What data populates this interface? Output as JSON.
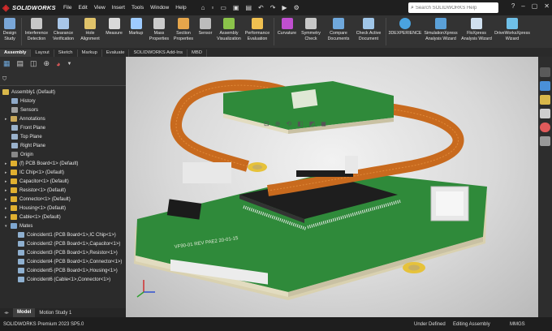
{
  "app": {
    "brand": "SOLIDWORKS"
  },
  "menu": [
    "File",
    "Edit",
    "View",
    "Insert",
    "Tools",
    "Window",
    "Help"
  ],
  "quick_access": [
    "home-icon",
    "new-icon",
    "open-icon",
    "save-icon",
    "print-icon",
    "undo-icon",
    "redo-icon",
    "rebuild-icon",
    "options-icon"
  ],
  "search": {
    "placeholder": "Search SOLIDWORKS Help"
  },
  "ribbon": [
    {
      "label": "Design\nStudy",
      "color": "#7aa7d8"
    },
    {
      "label": "Interference\nDetection",
      "color": "#c7c7c7"
    },
    {
      "label": "Clearance\nVerification",
      "color": "#a8c6e8"
    },
    {
      "label": "Hole\nAlignment",
      "color": "#e0c36a"
    },
    {
      "label": "Measure",
      "color": "#d9d9d9"
    },
    {
      "label": "Markup",
      "color": "#9ecbff"
    },
    {
      "label": "Mass\nProperties",
      "color": "#cccccc"
    },
    {
      "label": "Section\nProperties",
      "color": "#e6a64b"
    },
    {
      "label": "Sensor",
      "color": "#bcbcbc"
    },
    {
      "label": "Assembly\nVisualization",
      "color": "#8bc34a"
    },
    {
      "label": "Performance\nEvaluation",
      "color": "#f0c050"
    },
    {
      "label": "Curvature",
      "color": "#c04fd0"
    },
    {
      "label": "Symmetry\nCheck",
      "color": "#c8c8c8"
    },
    {
      "label": "Compare\nDocuments",
      "color": "#6fa8dc"
    },
    {
      "label": "Check Active\nDocument",
      "color": "#9fc5e8"
    },
    {
      "label": "3DEXPERIENCE",
      "color": "#4aa3df"
    },
    {
      "label": "SimulationXpress\nAnalysis Wizard",
      "color": "#5aa0d8"
    },
    {
      "label": "FloXpress\nAnalysis Wizard",
      "color": "#d0e0f0"
    },
    {
      "label": "DriveWorksXpress\nWizard",
      "color": "#6fc0e8"
    }
  ],
  "tabs": [
    "Assembly",
    "Layout",
    "Sketch",
    "Markup",
    "Evaluate",
    "SOLIDWORKS Add-Ins",
    "MBD"
  ],
  "active_tab": "Assembly",
  "tree": {
    "root": "Assembly1  (Default)",
    "items": [
      {
        "label": "History",
        "icon": "history-icon"
      },
      {
        "label": "Sensors",
        "icon": "sensors-icon"
      },
      {
        "label": "Annotations",
        "icon": "annotations-icon"
      },
      {
        "label": "Front Plane",
        "icon": "plane-icon"
      },
      {
        "label": "Top Plane",
        "icon": "plane-icon"
      },
      {
        "label": "Right Plane",
        "icon": "plane-icon"
      },
      {
        "label": "Origin",
        "icon": "origin-icon"
      },
      {
        "label": "(f) PCB Board<1> (Default)",
        "icon": "part-icon"
      },
      {
        "label": "IC Chip<1> (Default)",
        "icon": "part-icon"
      },
      {
        "label": "Capacitor<1> (Default)",
        "icon": "part-icon"
      },
      {
        "label": "Resistor<1> (Default)",
        "icon": "part-icon"
      },
      {
        "label": "Connector<1> (Default)",
        "icon": "part-icon"
      },
      {
        "label": "Housing<1> (Default)",
        "icon": "part-icon"
      },
      {
        "label": "Cable<1> (Default)",
        "icon": "part-icon"
      },
      {
        "label": "Mates",
        "icon": "mates-icon"
      },
      {
        "label": "Coincident1 (PCB Board<1>,IC Chip<1>)",
        "icon": "coincident-icon"
      },
      {
        "label": "Coincident2 (PCB Board<1>,Capacitor<1>)",
        "icon": "coincident-icon"
      },
      {
        "label": "Coincident3 (PCB Board<1>,Resistor<1>)",
        "icon": "coincident-icon"
      },
      {
        "label": "Coincident4 (PCB Board<1>,Connector<1>)",
        "icon": "coincident-icon"
      },
      {
        "label": "Coincident5 (PCB Board<1>,Housing<1>)",
        "icon": "coincident-icon"
      },
      {
        "label": "Coincident6 (Cable<1>,Connector<1>)",
        "icon": "coincident-icon"
      }
    ]
  },
  "bottom_tabs": [
    "Model",
    "Motion Study 1"
  ],
  "status": {
    "version": "SOLIDWORKS Premium 2023 SP5.0",
    "state": "Under Defined",
    "mode": "Editing Assembly",
    "units": "MMGS"
  },
  "board_label": "VF90-01 REV PAE2 20-01-15",
  "colors": {
    "pcb": "#2f8a3a",
    "cable": "#c86a1e",
    "chip": "#1e1e1e",
    "housing": "#ded6b6"
  }
}
